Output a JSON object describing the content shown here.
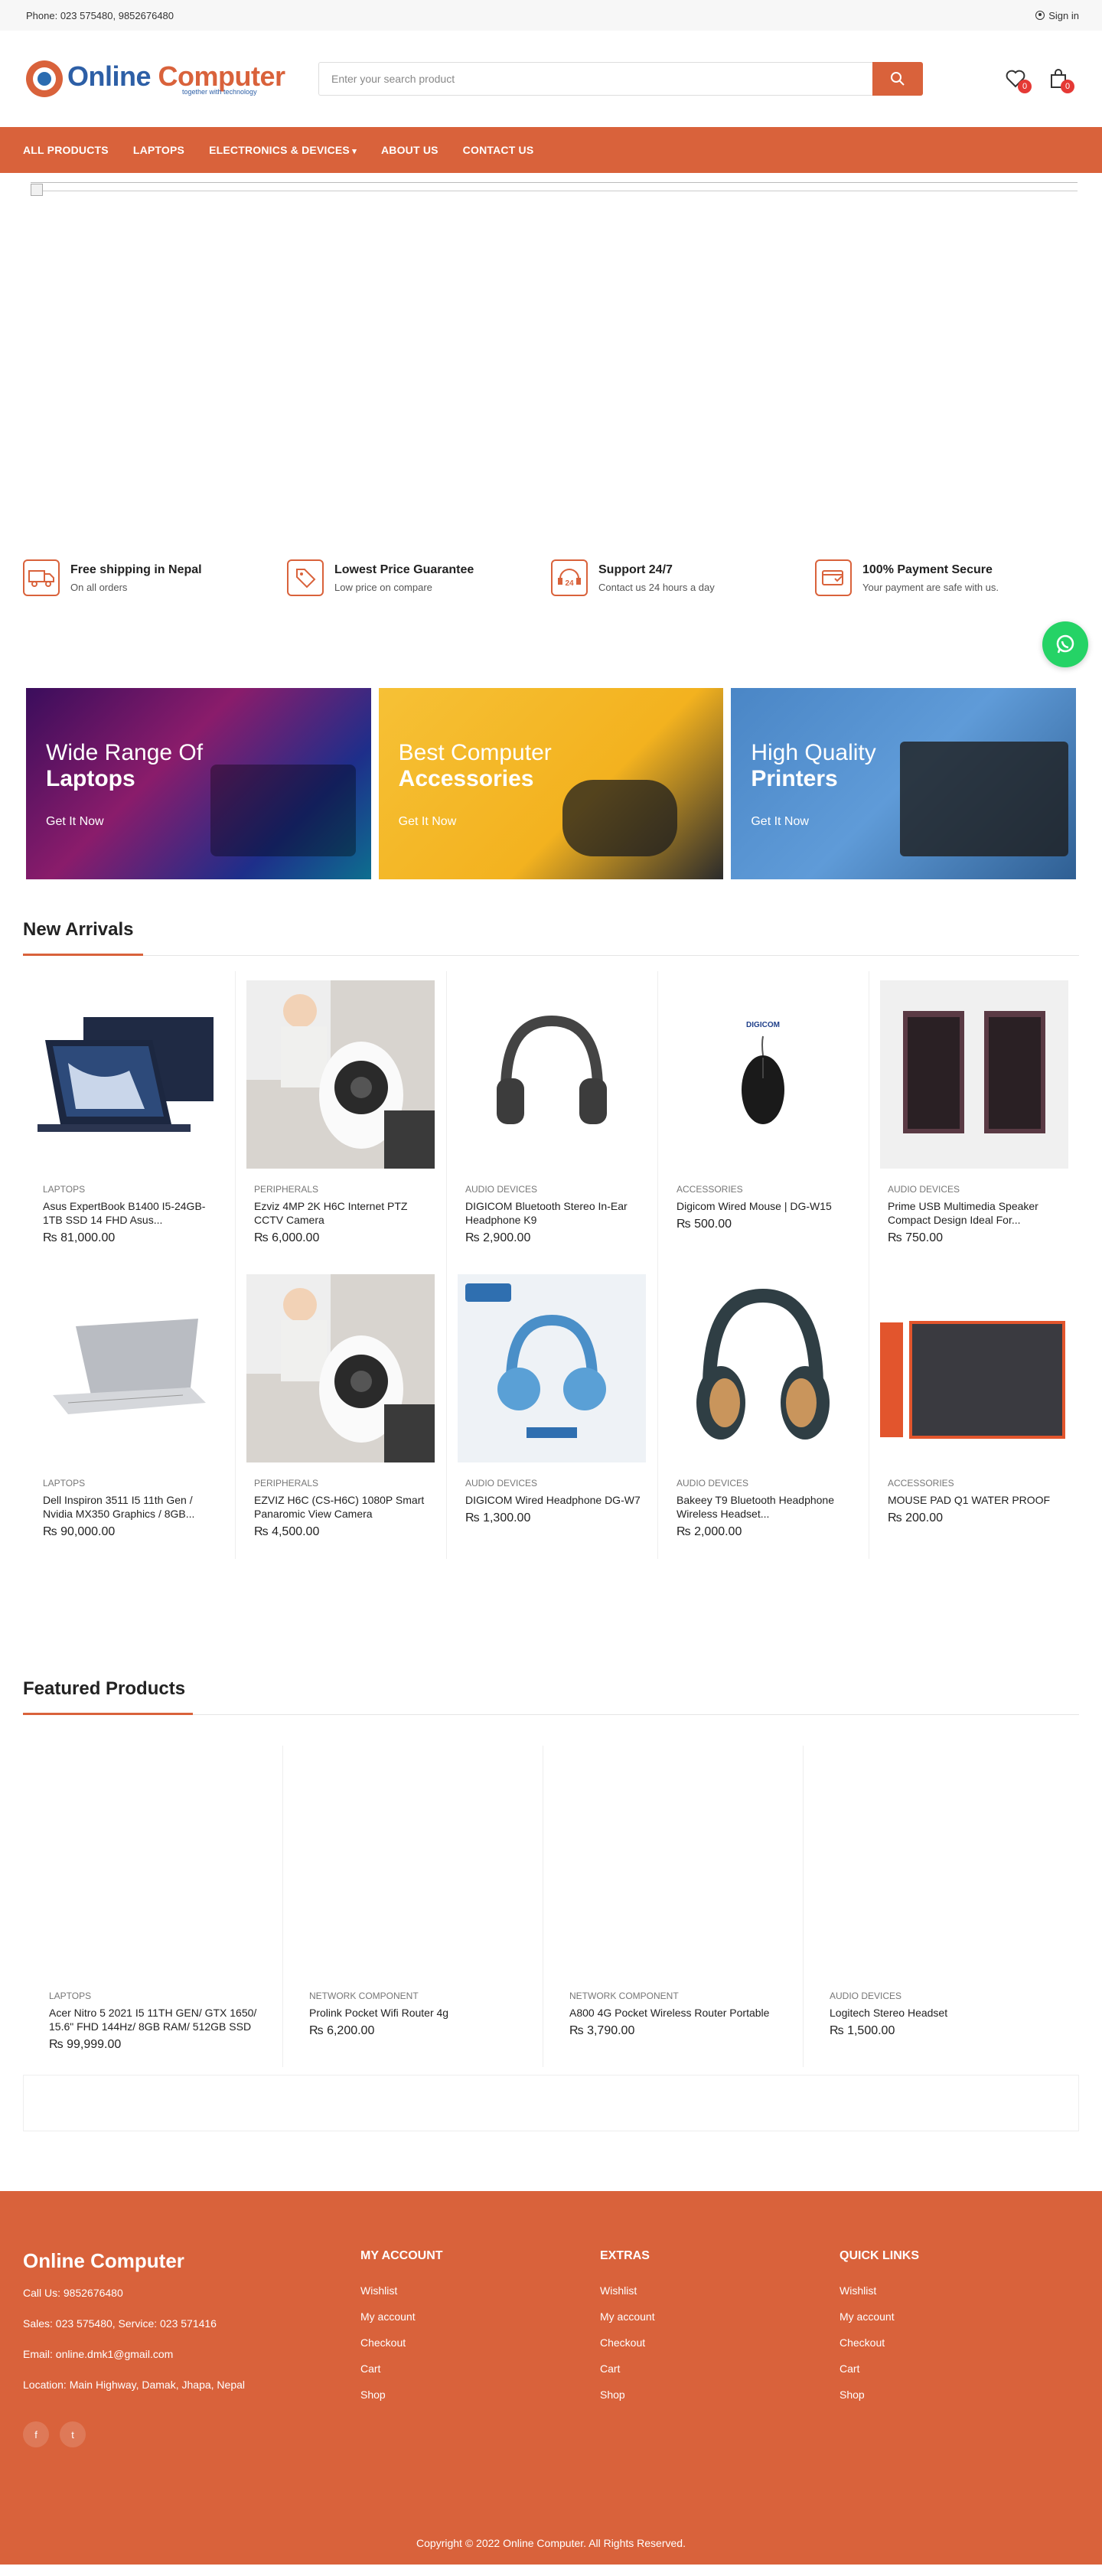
{
  "topbar": {
    "phone": "Phone: 023 575480, 9852676480",
    "signin": "Sign in"
  },
  "header": {
    "logo_name_a": "Online ",
    "logo_name_b": "Computer",
    "logo_tag": "together with technology",
    "search_placeholder": "Enter your search product",
    "wishlist_count": "0",
    "cart_count": "0"
  },
  "nav": [
    "ALL PRODUCTS",
    "LAPTOPS",
    "ELECTRONICS & DEVICES",
    "ABOUT US",
    "CONTACT US"
  ],
  "features": [
    {
      "icon": "truck-icon",
      "title": "Free shipping in Nepal",
      "sub": "On all orders"
    },
    {
      "icon": "price-tag-icon",
      "title": "Lowest Price Guarantee",
      "sub": "Low price on compare"
    },
    {
      "icon": "support-24-icon",
      "title": "Support 24/7",
      "sub": "Contact us 24 hours a day"
    },
    {
      "icon": "secure-payment-icon",
      "title": "100% Payment Secure",
      "sub": "Your payment are safe with us."
    }
  ],
  "banners": [
    {
      "line1": "Wide Range Of",
      "line2": "Laptops",
      "cta": "Get It Now"
    },
    {
      "line1": "Best Computer",
      "line2": "Accessories",
      "cta": "Get It Now"
    },
    {
      "line1": "High Quality",
      "line2": "Printers",
      "cta": "Get It Now"
    }
  ],
  "new_arrivals": {
    "title": "New Arrivals",
    "products": [
      {
        "cat": "LAPTOPS",
        "name": "Asus ExpertBook B1400 I5-24GB-1TB SSD 14 FHD Asus...",
        "price": "₨ 81,000.00",
        "img": "laptop-dark"
      },
      {
        "cat": "PERIPHERALS",
        "name": "Ezviz 4MP 2K H6C Internet PTZ CCTV Camera",
        "price": "₨ 6,000.00",
        "img": "camera"
      },
      {
        "cat": "AUDIO DEVICES",
        "name": "DIGICOM Bluetooth Stereo In-Ear Headphone K9",
        "price": "₨ 2,900.00",
        "img": "headphone"
      },
      {
        "cat": "ACCESSORIES",
        "name": "Digicom Wired Mouse | DG-W15",
        "price": "₨ 500.00",
        "img": "mouse"
      },
      {
        "cat": "AUDIO DEVICES",
        "name": "Prime USB Multimedia Speaker Compact Design Ideal For...",
        "price": "₨ 750.00",
        "img": "speaker"
      },
      {
        "cat": "LAPTOPS",
        "name": "Dell Inspiron 3511 I5 11th Gen / Nvidia MX350 Graphics / 8GB...",
        "price": "₨ 90,000.00",
        "img": "laptop-silver"
      },
      {
        "cat": "PERIPHERALS",
        "name": "EZVIZ H6C (CS-H6C) 1080P Smart Panaromic View Camera",
        "price": "₨ 4,500.00",
        "img": "camera"
      },
      {
        "cat": "AUDIO DEVICES",
        "name": "DIGICOM Wired Headphone DG-W7",
        "price": "₨ 1,300.00",
        "img": "headphone-blue"
      },
      {
        "cat": "AUDIO DEVICES",
        "name": "Bakeey T9 Bluetooth Headphone Wireless Headset...",
        "price": "₨ 2,000.00",
        "img": "headphone-gold"
      },
      {
        "cat": "ACCESSORIES",
        "name": "MOUSE PAD Q1 WATER PROOF",
        "price": "₨ 200.00",
        "img": "mousepad"
      }
    ]
  },
  "featured": {
    "title": "Featured Products",
    "products": [
      {
        "cat": "LAPTOPS",
        "name": "Acer Nitro 5 2021 I5 11TH GEN/ GTX 1650/ 15.6\" FHD 144Hz/ 8GB RAM/ 512GB SSD",
        "price": "₨ 99,999.00"
      },
      {
        "cat": "NETWORK COMPONENT",
        "name": "Prolink Pocket Wifi Router 4g",
        "price": "₨ 6,200.00"
      },
      {
        "cat": "NETWORK COMPONENT",
        "name": "A800 4G Pocket Wireless Router Portable",
        "price": "₨ 3,790.00"
      },
      {
        "cat": "AUDIO DEVICES",
        "name": "Logitech Stereo Headset",
        "price": "₨ 1,500.00"
      }
    ]
  },
  "footer": {
    "brand": "Online Computer",
    "call": "Call Us: 9852676480",
    "sales": "Sales: 023 575480, Service: 023 571416",
    "email": "Email: online.dmk1@gmail.com",
    "location": "Location: Main Highway, Damak, Jhapa, Nepal",
    "social": [
      "f",
      "t"
    ],
    "columns": [
      {
        "title": "MY ACCOUNT",
        "links": [
          "Wishlist",
          "My account",
          "Checkout",
          "Cart",
          "Shop"
        ]
      },
      {
        "title": "EXTRAS",
        "links": [
          "Wishlist",
          "My account",
          "Checkout",
          "Cart",
          "Shop"
        ]
      },
      {
        "title": "QUICK LINKS",
        "links": [
          "Wishlist",
          "My account",
          "Checkout",
          "Cart",
          "Shop"
        ]
      }
    ],
    "copyright": "Copyright © 2022 Online Computer. All Rights Reserved."
  },
  "colors": {
    "brand": "#d9623b",
    "blue": "#2d5fa6",
    "whatsapp": "#25d366"
  }
}
